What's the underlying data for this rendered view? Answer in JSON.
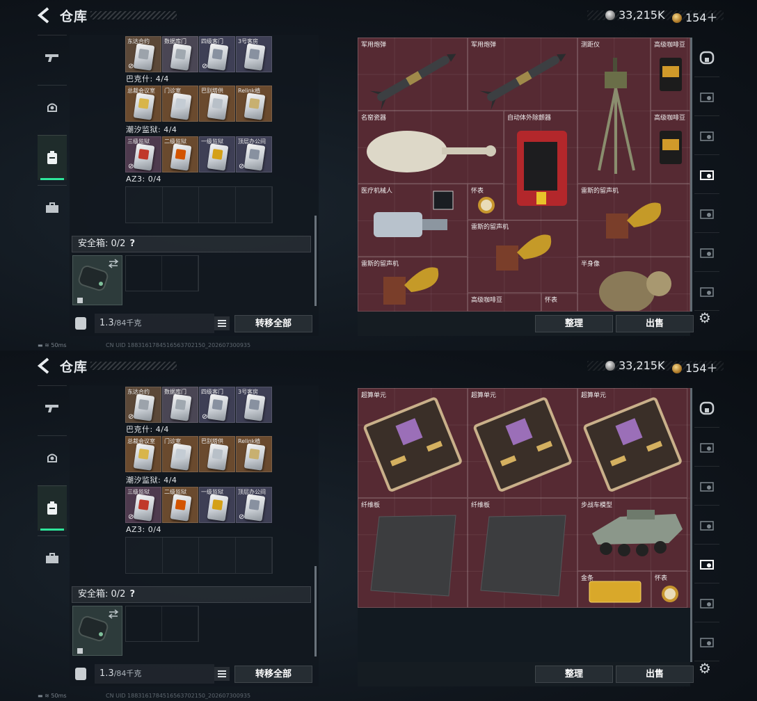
{
  "header": {
    "title": "仓库",
    "silver": "33,215K",
    "tickets": "154＋"
  },
  "left": {
    "row1_labels": [
      "东达合约",
      "数据库门",
      "四级客门",
      "3号客房"
    ],
    "group2_title": "巴克什: 4/4",
    "row2_labels": [
      "总裁会议室",
      "门诊室",
      "巴别塔供",
      "Relink植"
    ],
    "group3_title": "潮汐监狱: 4/4",
    "row3_labels": [
      "三级监狱",
      "二级监狱",
      "一级监狱",
      "顶层办公间"
    ],
    "group4_title": "AZ3: 0/4",
    "safe_label": "安全箱: 0/2",
    "safe_help": "?",
    "weight_value": "1.3",
    "weight_max": "/84千克",
    "transfer_all": "转移全部"
  },
  "right": {
    "sort": "整理",
    "sell": "出售"
  },
  "status": {
    "ping": "50ms",
    "uid": "CN UID 1883161784516563702150_202607300935"
  },
  "screen1_items": [
    "军用炮弹",
    "军用炮弹",
    "测距仪",
    "高级咖啡豆",
    "名窑瓷器",
    "自动体外除颤器",
    "高级咖啡豆",
    "医疗机械人",
    "怀表",
    "雷斯的留声机",
    "雷斯的留声机",
    "雷斯的留声机",
    "半身像",
    "高级咖啡豆",
    "怀表"
  ],
  "screen2_items": [
    "超算单元",
    "超算单元",
    "超算单元",
    "纤维板",
    "纤维板",
    "步战车模型",
    "金条",
    "怀表"
  ]
}
